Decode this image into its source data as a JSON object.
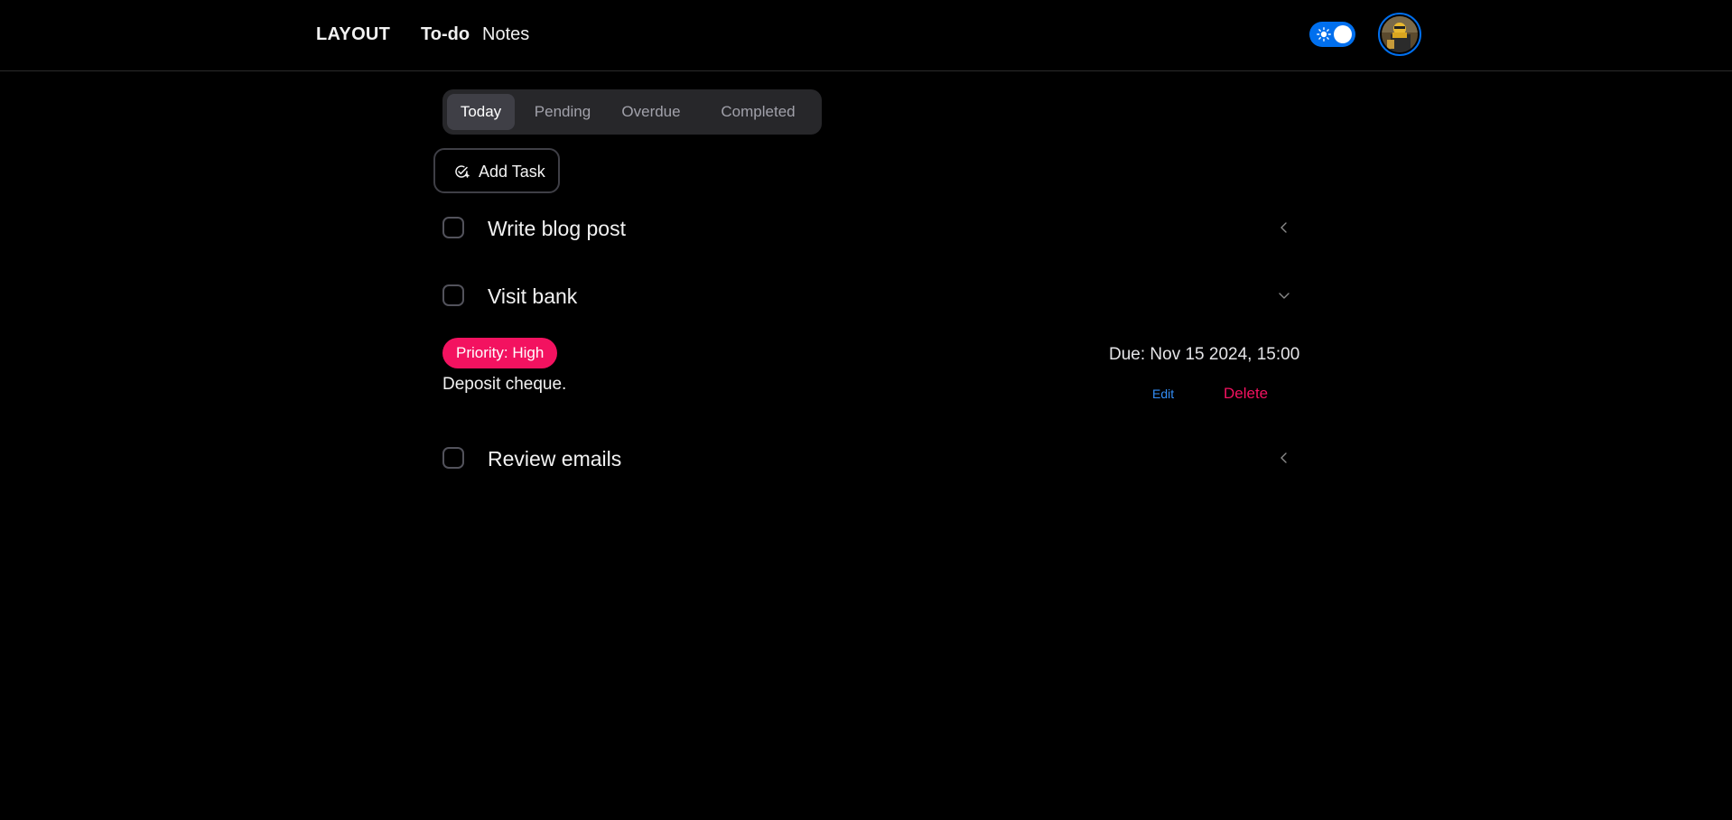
{
  "navbar": {
    "brand": "LAYOUT",
    "links": [
      "To-do",
      "Notes"
    ]
  },
  "theme_toggle": {
    "checked": true,
    "accent": "#006fee"
  },
  "tabs": [
    {
      "label": "Today",
      "active": true
    },
    {
      "label": "Pending",
      "active": false
    },
    {
      "label": "Overdue",
      "active": false
    },
    {
      "label": "Completed",
      "active": false
    }
  ],
  "add_task": {
    "label": "Add Task",
    "icon": "calendar-check-icon"
  },
  "tasks": [
    {
      "title": "Write blog post",
      "expanded": false,
      "icon": "chevron-left-icon"
    },
    {
      "title": "Visit bank",
      "expanded": true,
      "icon": "chevron-down-icon",
      "priority": "Priority: High",
      "description": "Deposit cheque.",
      "due": "Due: Nov 15 2024, 15:00",
      "edit_label": "Edit",
      "delete_label": "Delete"
    },
    {
      "title": "Review emails",
      "expanded": false,
      "icon": "chevron-left-icon"
    }
  ],
  "colors": {
    "background": "#000000",
    "primary": "#006fee",
    "danger": "#f31260",
    "tab_bg": "#27272a",
    "tab_active": "#3f3f46"
  }
}
